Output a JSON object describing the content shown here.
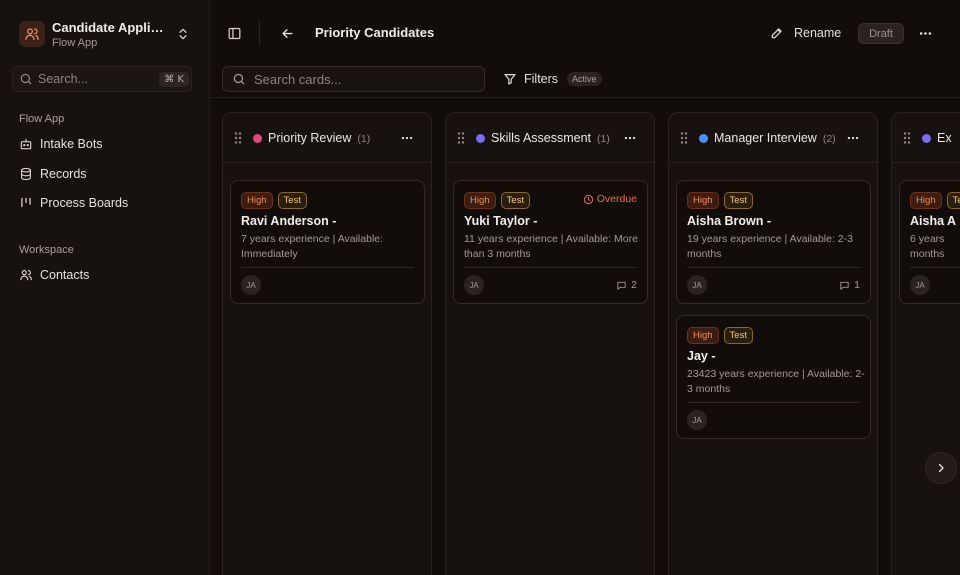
{
  "app": {
    "title": "Candidate Applicat...",
    "subtitle": "Flow App"
  },
  "sidebar": {
    "search_placeholder": "Search...",
    "shortcut": "⌘ K",
    "sections": [
      {
        "label": "Flow App",
        "items": [
          {
            "label": "Intake Bots",
            "icon": "bot-icon"
          },
          {
            "label": "Records",
            "icon": "database-icon"
          },
          {
            "label": "Process Boards",
            "icon": "kanban-icon"
          }
        ]
      },
      {
        "label": "Workspace",
        "items": [
          {
            "label": "Contacts",
            "icon": "users-icon"
          }
        ]
      }
    ]
  },
  "header": {
    "title": "Priority Candidates",
    "rename_label": "Rename",
    "status_badge": "Draft"
  },
  "toolbar": {
    "search_placeholder": "Search cards...",
    "filters_label": "Filters",
    "filters_status": "Active"
  },
  "board": {
    "columns": [
      {
        "title": "Priority Review",
        "count": "(1)",
        "color": "#e2467e",
        "cards": [
          {
            "priority": "High",
            "tag": "Test",
            "name": "Ravi Anderson -",
            "description": "7 years experience | Available: Immediately",
            "assignee": "JA",
            "overdue": "",
            "comments": ""
          }
        ]
      },
      {
        "title": "Skills Assessment",
        "count": "(1)",
        "color": "#7b6cf2",
        "cards": [
          {
            "priority": "High",
            "tag": "Test",
            "name": "Yuki Taylor -",
            "description": "11 years experience | Available: More than 3 months",
            "assignee": "JA",
            "overdue": "Overdue",
            "comments": "2"
          }
        ]
      },
      {
        "title": "Manager Interview",
        "count": "(2)",
        "color": "#4f8ff7",
        "cards": [
          {
            "priority": "High",
            "tag": "Test",
            "name": "Aisha Brown -",
            "description": "19 years experience | Available: 2-3 months",
            "assignee": "JA",
            "overdue": "",
            "comments": "1"
          },
          {
            "priority": "High",
            "tag": "Test",
            "name": "Jay -",
            "description": "23423 years experience | Available: 2-3 months",
            "assignee": "JA",
            "overdue": "",
            "comments": ""
          }
        ]
      },
      {
        "title": "Ex",
        "count": "",
        "color": "#7b6cf2",
        "cards": [
          {
            "priority": "High",
            "tag": "Test",
            "name": "Aisha A",
            "description": "6 years months",
            "assignee": "JA",
            "overdue": "",
            "comments": ""
          }
        ]
      }
    ]
  }
}
